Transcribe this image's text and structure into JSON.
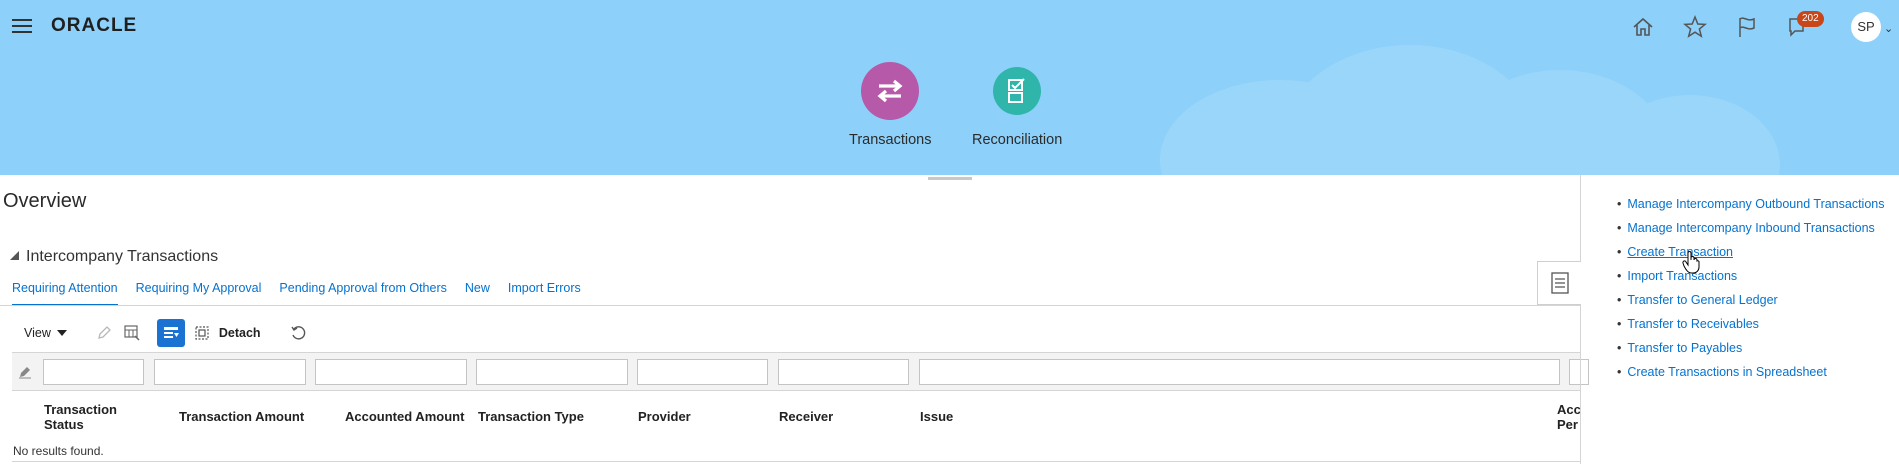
{
  "header": {
    "logo": "ORACLE",
    "notifications_count": "202",
    "avatar_initials": "SP",
    "icons": [
      "home-icon",
      "favorites-star-icon",
      "watchlist-flag-icon",
      "notifications-bell-icon"
    ],
    "apps": [
      {
        "label": "Transactions",
        "icon": "swap-arrows-icon",
        "color": "#b659a8"
      },
      {
        "label": "Reconciliation",
        "icon": "checklist-icon",
        "color": "#2fb5aa"
      }
    ],
    "bg_color": "#8dd0f9"
  },
  "page": {
    "title": "Overview",
    "section_title": "Intercompany Transactions"
  },
  "tabs": [
    {
      "label": "Requiring Attention",
      "active": true
    },
    {
      "label": "Requiring My Approval"
    },
    {
      "label": "Pending Approval from Others"
    },
    {
      "label": "New"
    },
    {
      "label": "Import Errors"
    }
  ],
  "toolbar": {
    "view_label": "View",
    "detach_label": "Detach"
  },
  "table": {
    "columns": [
      "Transaction\nStatus",
      "Transaction Amount",
      "Accounted Amount",
      "Transaction Type",
      "Provider",
      "Receiver",
      "Issue",
      "Acc\nPer"
    ],
    "empty_message": "No results found."
  },
  "tasks": [
    "Manage Intercompany Outbound Transactions",
    "Manage Intercompany Inbound Transactions",
    "Create Transaction",
    "Import Transactions",
    "Transfer to General Ledger",
    "Transfer to Receivables",
    "Transfer to Payables",
    "Create Transactions in Spreadsheet"
  ],
  "accent_color": "#0572ce"
}
